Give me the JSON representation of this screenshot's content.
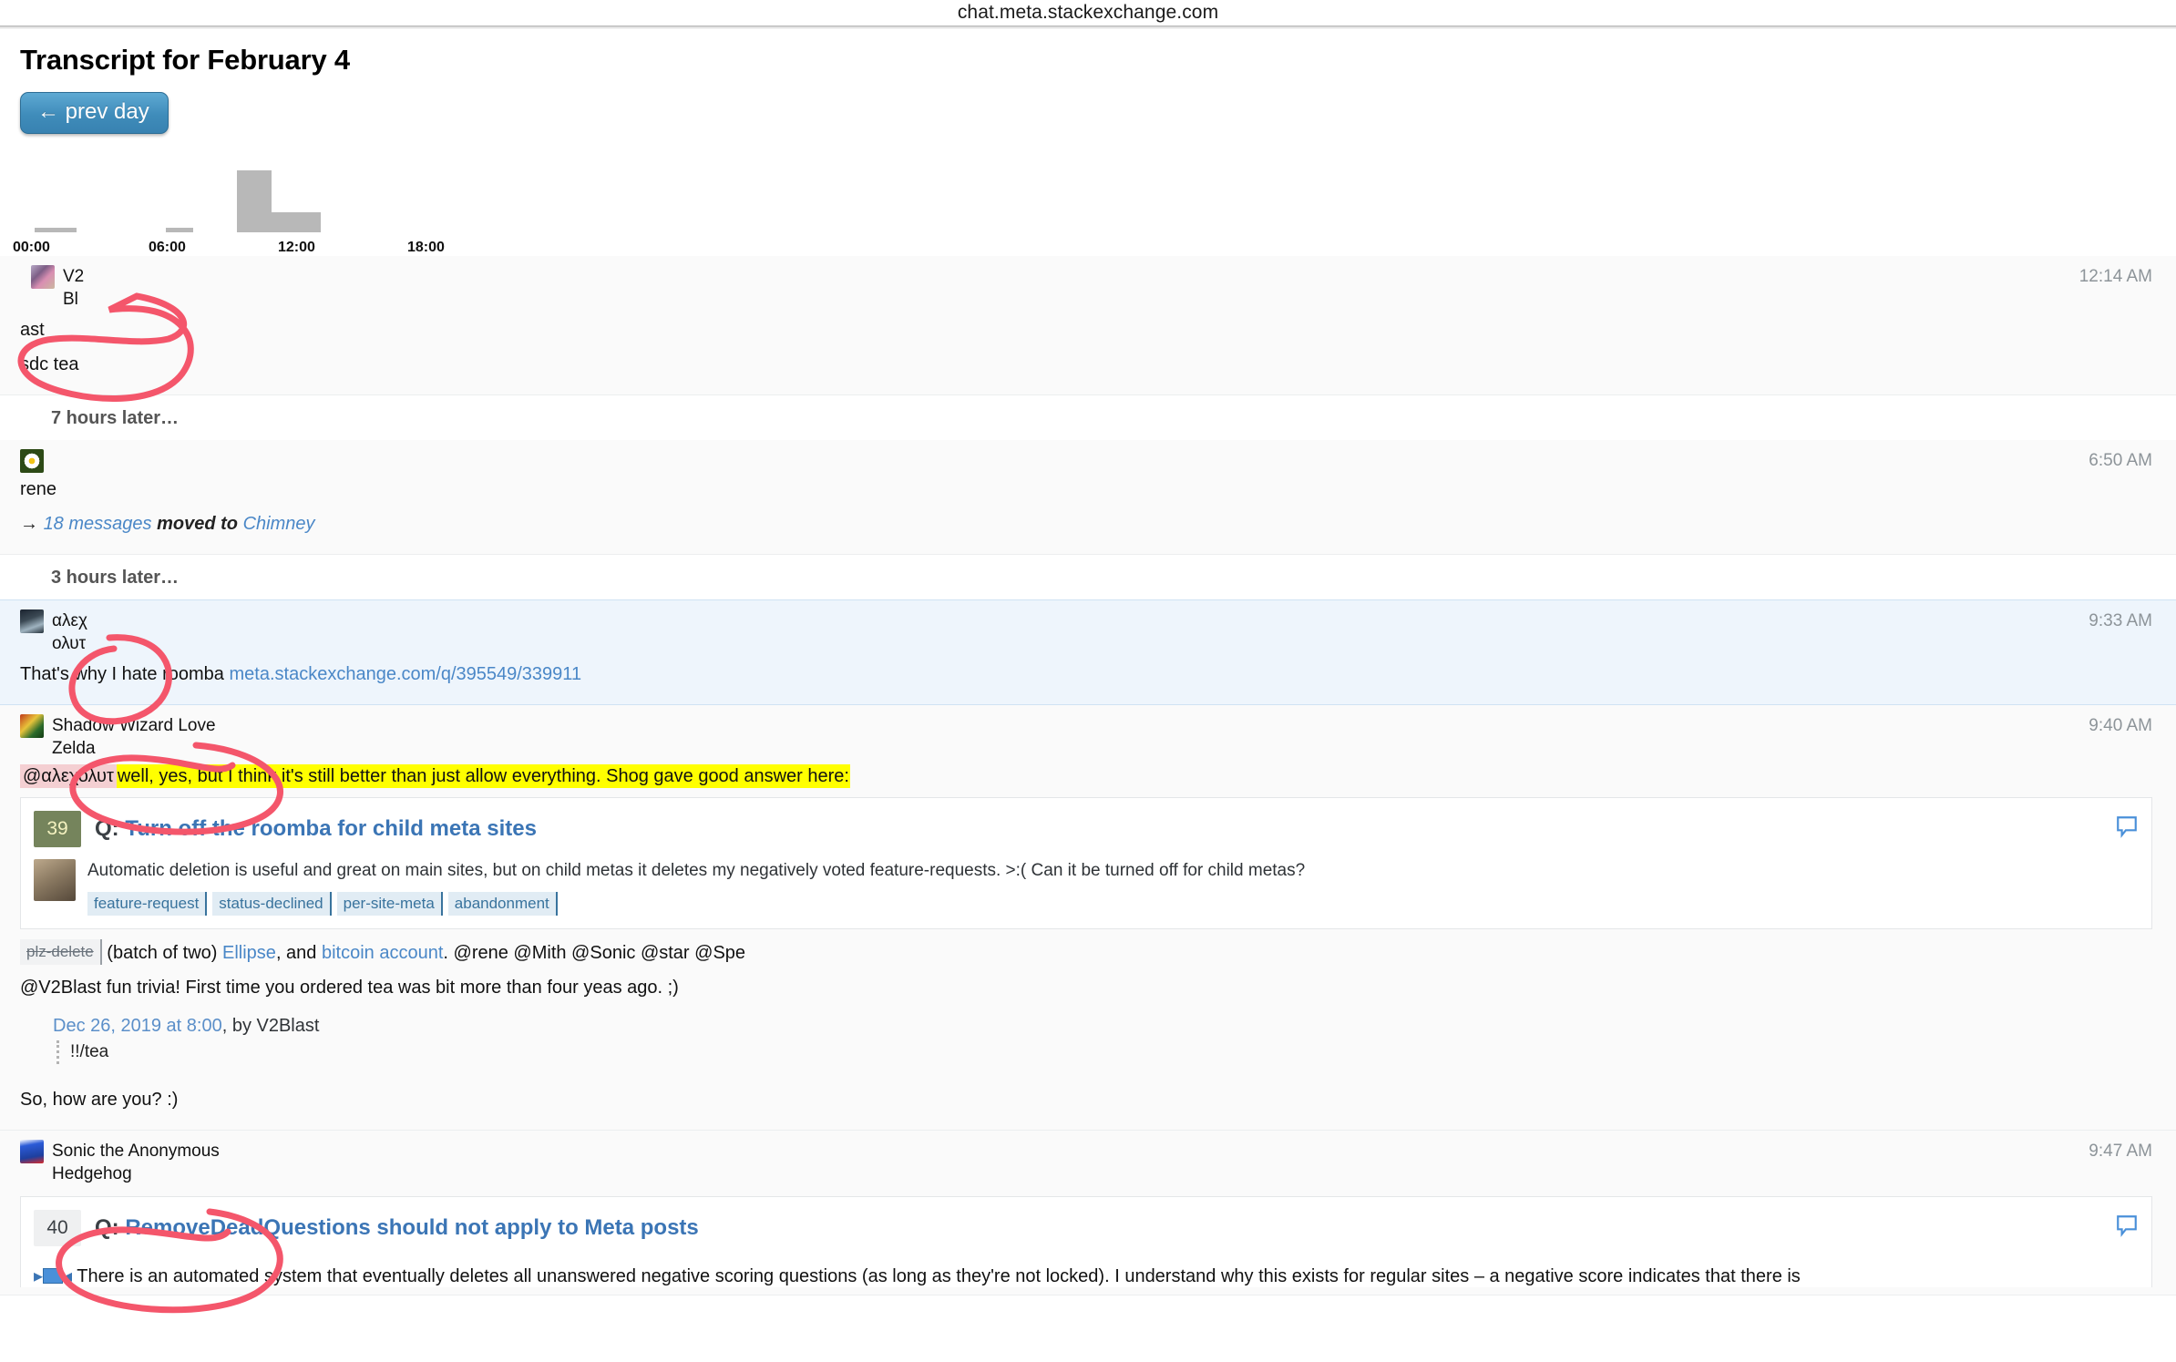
{
  "browser": {
    "url": "chat.meta.stackexchange.com"
  },
  "page": {
    "title": "Transcript for February 4",
    "prev_day_label": "← prev day"
  },
  "timeline": {
    "ticks": [
      "00:00",
      "06:00",
      "12:00",
      "18:00"
    ],
    "chart_data": {
      "type": "bar",
      "title": "",
      "xlabel": "",
      "ylabel": "",
      "categories": [
        "00:00",
        "06:00",
        "09:00",
        "10:30"
      ],
      "values": [
        2,
        2,
        48,
        15
      ],
      "ylim": [
        0,
        50
      ],
      "grid": false,
      "legend": "none"
    }
  },
  "transcript": {
    "entries": [
      {
        "id": "v2blast-1214",
        "user": "V2Blast",
        "user_line1": "V2",
        "user_line2": "Bl",
        "user_line3": "ast",
        "time": "12:14 AM",
        "message": "sdc tea"
      },
      {
        "gap": "7 hours later…"
      },
      {
        "id": "rene-650",
        "user": "rene",
        "time": "6:50 AM",
        "move_arrow": "→",
        "move_count": "18 messages",
        "move_mid": "moved to",
        "move_room": "Chimney"
      },
      {
        "gap": "3 hours later…"
      },
      {
        "id": "alexolut-933",
        "user_line1": "αλεχ",
        "user_line2": "ολυτ",
        "time": "9:33 AM",
        "message_text": "That's why I hate roomba",
        "message_link": "meta.stackexchange.com/q/395549/339911"
      },
      {
        "id": "shadow-940",
        "user_line1": "Shadow Wizard Love",
        "user_line2": "Zelda",
        "time": "9:40 AM",
        "mention": "@αλεχολυτ",
        "highlighted": "well, yes, but I think it's still better than just allow everything. Shog gave good answer here:",
        "onebox": {
          "votes": "39",
          "q_prefix": "Q:",
          "title": "Turn off the roomba for child meta sites",
          "excerpt": "Automatic deletion is useful and great on main sites, but on child metas it deletes my negatively voted feature-requests. >:( Can it be turned off for child metas?",
          "tags": [
            "feature-request",
            "status-declined",
            "per-site-meta",
            "abandonment"
          ],
          "reply_icon": "speech-bubble-icon"
        },
        "msg_plz_tag": "plz-delete",
        "msg_plz_rest1": "(batch of two)",
        "msg_plz_link1": "Ellipse",
        "msg_plz_mid": ", and",
        "msg_plz_link2": "bitcoin account",
        "msg_plz_rest2": ". @rene @Mith @Sonic @star @Spe",
        "msg_trivia": "@V2Blast fun trivia! First time you ordered tea was bit more than four yeas ago. ;)",
        "quote_date": "Dec 26, 2019 at 8:00",
        "quote_by": ", by V2Blast",
        "quote_text": "!!/tea",
        "msg_howareyou": "So, how are you? :)"
      },
      {
        "id": "sonic-947",
        "user_line1": "Sonic the Anonymous",
        "user_line2": "Hedgehog",
        "time": "9:47 AM",
        "onebox": {
          "votes": "40",
          "q_prefix": "Q:",
          "title": "RemoveDeadQuestions should not apply to Meta posts",
          "excerpt": "There is an automated system that eventually deletes all unanswered negative scoring questions (as long as they're not locked). I understand why this exists for regular sites – a negative score indicates that there is",
          "reply_icon": "speech-bubble-icon"
        }
      }
    ]
  },
  "colors": {
    "link": "#4a87c7",
    "accent_button": "#3f8cba",
    "highlight_yellow": "#ffff00",
    "mention_pink": "#f4cfd2",
    "vote_answered": "#75845c",
    "annotation_red": "#f4566b"
  }
}
